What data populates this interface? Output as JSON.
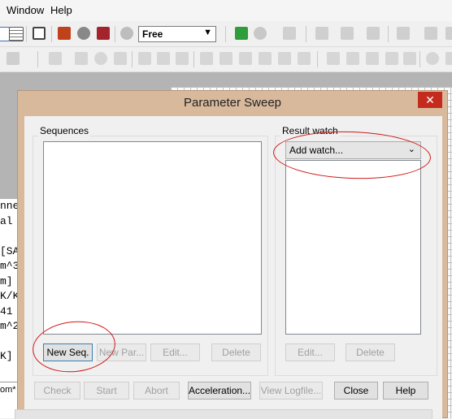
{
  "menu": {
    "items": [
      "Window",
      "Help"
    ]
  },
  "toolbar": {
    "mode_value": "Free"
  },
  "left_doc": {
    "lines": [
      "nne",
      "al",
      "",
      "[SA",
      "m^3",
      "m]",
      "K/K",
      "41",
      "m^2",
      "",
      "K]"
    ],
    "tab_label": "om*"
  },
  "dialog": {
    "title": "Parameter Sweep",
    "close_label": "✕",
    "sequences": {
      "label": "Sequences",
      "buttons": {
        "new_seq": "New Seq.",
        "new_par": "New Par...",
        "edit": "Edit...",
        "delete": "Delete"
      }
    },
    "result_watch": {
      "label": "Result watch",
      "select_value": "Add watch...",
      "buttons": {
        "edit": "Edit...",
        "delete": "Delete"
      }
    },
    "bottom_buttons": {
      "check": "Check",
      "start": "Start",
      "abort": "Abort",
      "acceleration": "Acceleration...",
      "view_logfile": "View Logfile...",
      "close": "Close",
      "help": "Help"
    }
  },
  "colors": {
    "title_bar": "#d9b99c",
    "close_red": "#c42b1c",
    "annotation": "#d01818"
  }
}
